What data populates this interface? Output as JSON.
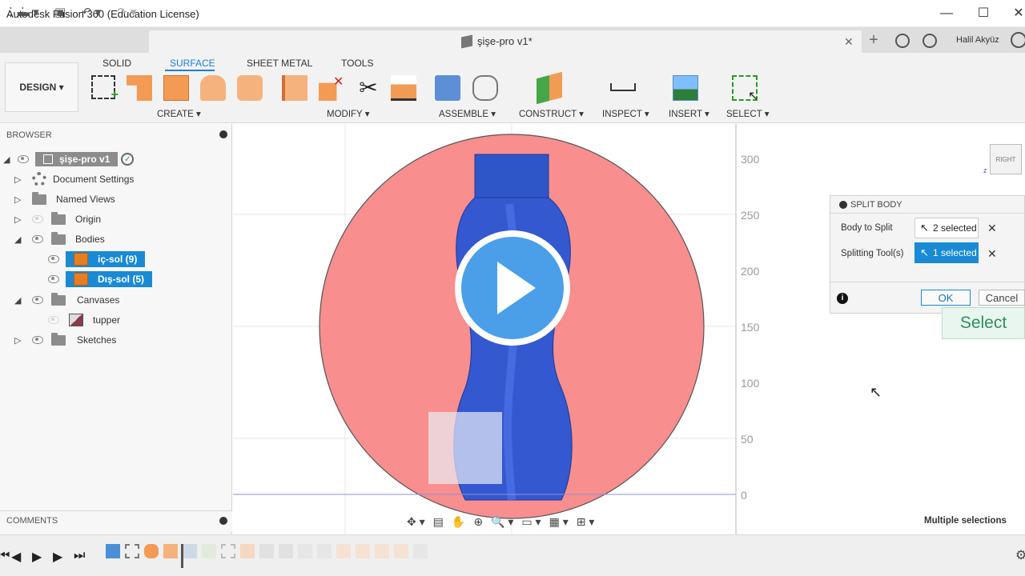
{
  "window": {
    "title": "Autodesk Fusion 360 (Education License)",
    "minimize": "—",
    "maximize": "☐",
    "close": "✕"
  },
  "appbar": {
    "doc_title": "şişe-pro v1*",
    "doc_close": "✕",
    "user_name": "Halil Akyüz"
  },
  "ribbon": {
    "workspace": "DESIGN ▾",
    "tabs": [
      "SOLID",
      "SURFACE",
      "SHEET METAL",
      "TOOLS"
    ],
    "active_tab": "SURFACE",
    "groups": [
      "CREATE ▾",
      "MODIFY ▾",
      "ASSEMBLE ▾",
      "CONSTRUCT ▾",
      "INSPECT ▾",
      "INSERT ▾",
      "SELECT ▾"
    ]
  },
  "browser": {
    "header": "BROWSER",
    "root": "şişe-pro v1",
    "items": {
      "document_settings": "Document Settings",
      "named_views": "Named Views",
      "origin": "Origin",
      "bodies": "Bodies",
      "body1": "iç-sol (9)",
      "body2": "Dış-sol (5)",
      "canvases": "Canvases",
      "canvas1": "tupper",
      "sketches": "Sketches"
    }
  },
  "comments": {
    "label": "COMMENTS"
  },
  "viewcube": {
    "label": "RIGHT"
  },
  "ruler": {
    "ticks": [
      "300",
      "250",
      "200",
      "150",
      "100",
      "50",
      "0"
    ]
  },
  "dialog": {
    "title": "SPLIT BODY",
    "body_to_split_label": "Body to Split",
    "body_to_split_value": "2 selected",
    "splitting_tools_label": "Splitting Tool(s)",
    "splitting_tools_value": "1 selected",
    "ok": "OK",
    "cancel": "Cancel",
    "select_tooltip": "Select"
  },
  "status": {
    "multi_selection": "Multiple selections"
  },
  "colors": {
    "accent": "#1a8ad4",
    "canvas_circle": "#f88e8e",
    "bottle": "#2e55c8"
  }
}
